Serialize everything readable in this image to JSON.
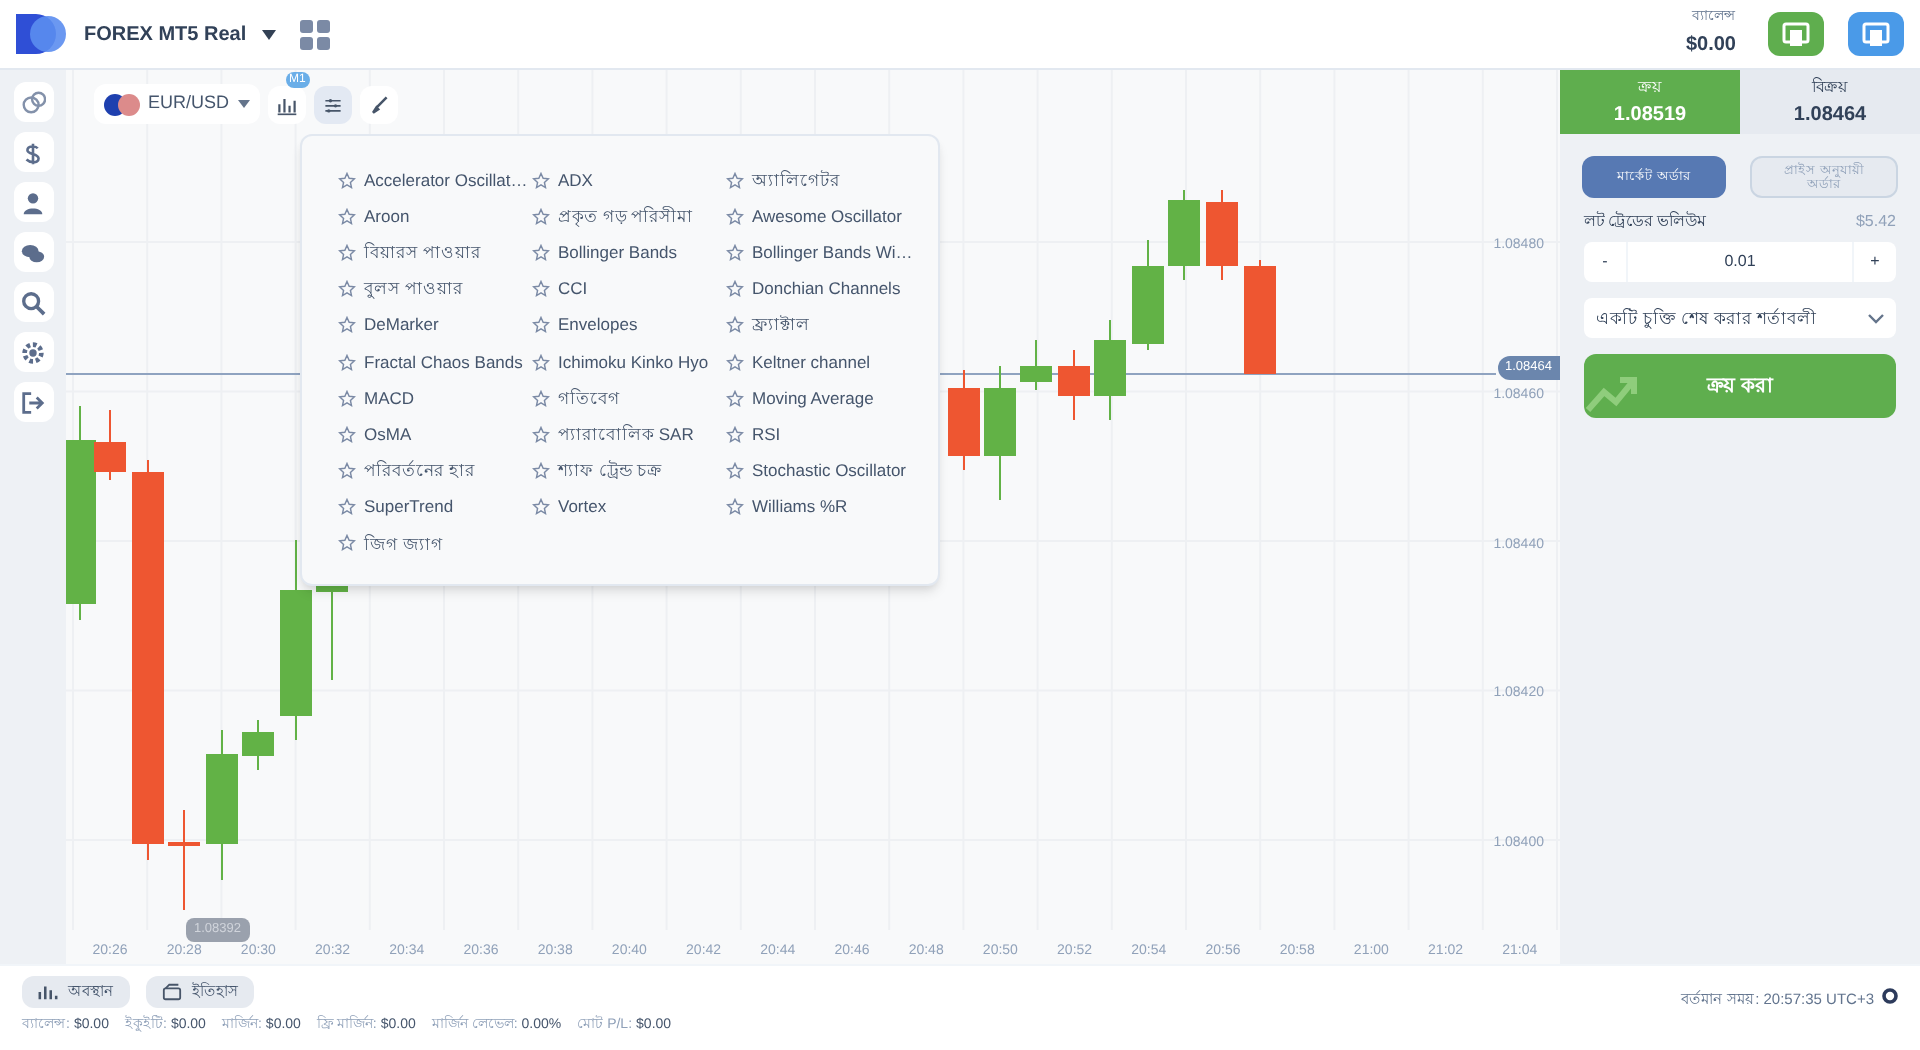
{
  "header": {
    "account": "FOREX MT5 Real",
    "balance_label": "ব্যালেন্স",
    "balance": "$0.00"
  },
  "chart_toolbar": {
    "pair": "EUR/USD",
    "tools": [
      {
        "kind": "chart-type",
        "badge": "M1",
        "selected": false
      },
      {
        "kind": "indicators",
        "selected": true
      },
      {
        "kind": "drawing",
        "selected": false
      }
    ]
  },
  "indicators": [
    {
      "label": "Accelerator Oscillat…"
    },
    {
      "label": "ADX"
    },
    {
      "label": "অ্যালিগেটর"
    },
    {
      "label": "Aroon"
    },
    {
      "label": "প্রকৃত গড় পরিসীমা"
    },
    {
      "label": "Awesome Oscillator"
    },
    {
      "label": "বিয়ারস পাওয়ার"
    },
    {
      "label": "Bollinger Bands"
    },
    {
      "label": "Bollinger Bands Wi…"
    },
    {
      "label": "বুলস পাওয়ার"
    },
    {
      "label": "CCI"
    },
    {
      "label": "Donchian Channels"
    },
    {
      "label": "DeMarker"
    },
    {
      "label": "Envelopes"
    },
    {
      "label": "ফ্র্যাক্টাল"
    },
    {
      "label": "Fractal Chaos Bands"
    },
    {
      "label": "Ichimoku Kinko Hyo"
    },
    {
      "label": "Keltner channel"
    },
    {
      "label": "MACD"
    },
    {
      "label": "গতিবেগ"
    },
    {
      "label": "Moving Average"
    },
    {
      "label": "OsMA"
    },
    {
      "label": "প্যারাবোলিক SAR"
    },
    {
      "label": "RSI"
    },
    {
      "label": "পরিবর্তনের হার"
    },
    {
      "label": "শ্যাফ ট্রেন্ড চক্র"
    },
    {
      "label": "Stochastic Oscillator"
    },
    {
      "label": "SuperTrend"
    },
    {
      "label": "Vortex"
    },
    {
      "label": "Williams %R"
    },
    {
      "label": "জিগ জ্যাগ"
    }
  ],
  "chart": {
    "price_axis": [
      "1.08480",
      "1.08460",
      "1.08440",
      "1.08420",
      "1.08400"
    ],
    "time_axis": [
      "20:26",
      "20:28",
      "20:30",
      "20:32",
      "20:34",
      "20:36",
      "20:38",
      "20:40",
      "20:42",
      "20:44",
      "20:46",
      "20:48",
      "20:50",
      "20:52",
      "20:54",
      "20:56",
      "20:58",
      "21:00",
      "21:02",
      "21:04"
    ],
    "current_price": "1.08464",
    "low_marker": "1.08392"
  },
  "trade_panel": {
    "sides": [
      {
        "label": "ক্রয়",
        "price": "1.08519",
        "selected": true
      },
      {
        "label": "বিক্রয়",
        "price": "1.08464",
        "selected": false
      }
    ],
    "order_types": [
      {
        "label": "মার্কেট অর্ডার",
        "selected": true
      },
      {
        "label": "প্রাইস অনুযায়ী অর্ডার",
        "selected": false
      }
    ],
    "volume_label": "লট ট্রেডের ভলিউম",
    "volume_cost": "$5.42",
    "minus": "-",
    "volume": "0.01",
    "plus": "+",
    "conditions": "একটি চুক্তি শেষ করার শর্তাবলী",
    "buy_button": "ক্রয় করা"
  },
  "bottom": {
    "tabs": [
      {
        "kind": "positions",
        "label": "অবস্থান"
      },
      {
        "kind": "history",
        "label": "ইতিহাস"
      }
    ],
    "stats": [
      {
        "label": "ব্যালেন্স:",
        "value": "$0.00"
      },
      {
        "label": "ইকুইটি:",
        "value": "$0.00"
      },
      {
        "label": "মার্জিন:",
        "value": "$0.00"
      },
      {
        "label": "ফ্রি মার্জিন:",
        "value": "$0.00"
      },
      {
        "label": "মার্জিন লেভেল:",
        "value": "0.00%"
      },
      {
        "label": "মোট P/L:",
        "value": "$0.00"
      }
    ],
    "time": "বর্তমান সময়: 20:57:35 UTC+3"
  }
}
